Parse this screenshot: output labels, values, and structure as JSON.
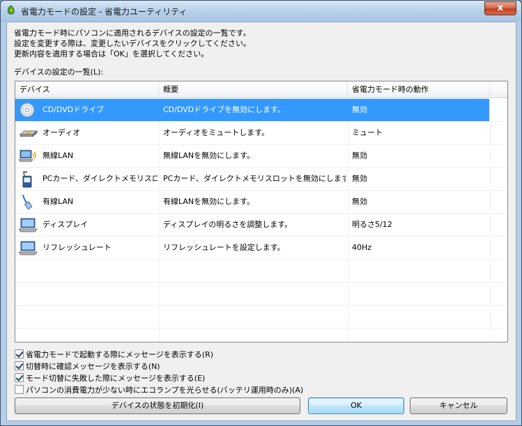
{
  "window": {
    "title": "省電力モードの設定 - 省電力ユーティリティ",
    "close_glyph": "x"
  },
  "description": {
    "line1": "省電力モード時にパソコンに適用されるデバイスの設定の一覧です。",
    "line2": "設定を変更する際は、変更したいデバイスをクリックしてください。",
    "line3": "更新内容を適用する場合は「OK」を選択してください。"
  },
  "list": {
    "label": "デバイスの設定の一覧(L):",
    "columns": [
      "デバイス",
      "概要",
      "省電力モード時の動作"
    ],
    "rows": [
      {
        "device": "CD/DVDドライブ",
        "summary": "CD/DVDドライブを無効にします。",
        "action": "無効",
        "icon": "cd-dvd-icon",
        "selected": true
      },
      {
        "device": "オーディオ",
        "summary": "オーディオをミュートします。",
        "action": "ミュート",
        "icon": "audio-icon",
        "selected": false
      },
      {
        "device": "無線LAN",
        "summary": "無線LANを無効にします。",
        "action": "無効",
        "icon": "wireless-lan-icon",
        "selected": false
      },
      {
        "device": "PCカード、ダイレクトメモリスロット",
        "summary": "PCカード、ダイレクトメモリスロットを無効にします。",
        "action": "無効",
        "icon": "pc-card-icon",
        "selected": false
      },
      {
        "device": "有線LAN",
        "summary": "有線LANを無効にします。",
        "action": "無効",
        "icon": "wired-lan-icon",
        "selected": false
      },
      {
        "device": "ディスプレイ",
        "summary": "ディスプレイの明るさを調整します。",
        "action": "明るさ5/12",
        "icon": "display-icon",
        "selected": false
      },
      {
        "device": "リフレッシュレート",
        "summary": "リフレッシュレートを設定します。",
        "action": "40Hz",
        "icon": "refresh-rate-icon",
        "selected": false
      }
    ]
  },
  "options": [
    {
      "label": "省電力モードで起動する際にメッセージを表示する(R)",
      "checked": true
    },
    {
      "label": "切替時に確認メッセージを表示する(N)",
      "checked": true
    },
    {
      "label": "モード切替に失敗した際にメッセージを表示する(E)",
      "checked": true
    },
    {
      "label": "パソコンの消費電力が少ない時にエコランプを光らせる(バッテリ運用時のみ)(A)",
      "checked": false
    }
  ],
  "buttons": {
    "reset": "デバイスの状態を初期化(I)",
    "ok": "OK",
    "cancel": "キャンセル"
  },
  "colors": {
    "selection": "#3399ff",
    "titlebar": "#b8d0ea"
  }
}
